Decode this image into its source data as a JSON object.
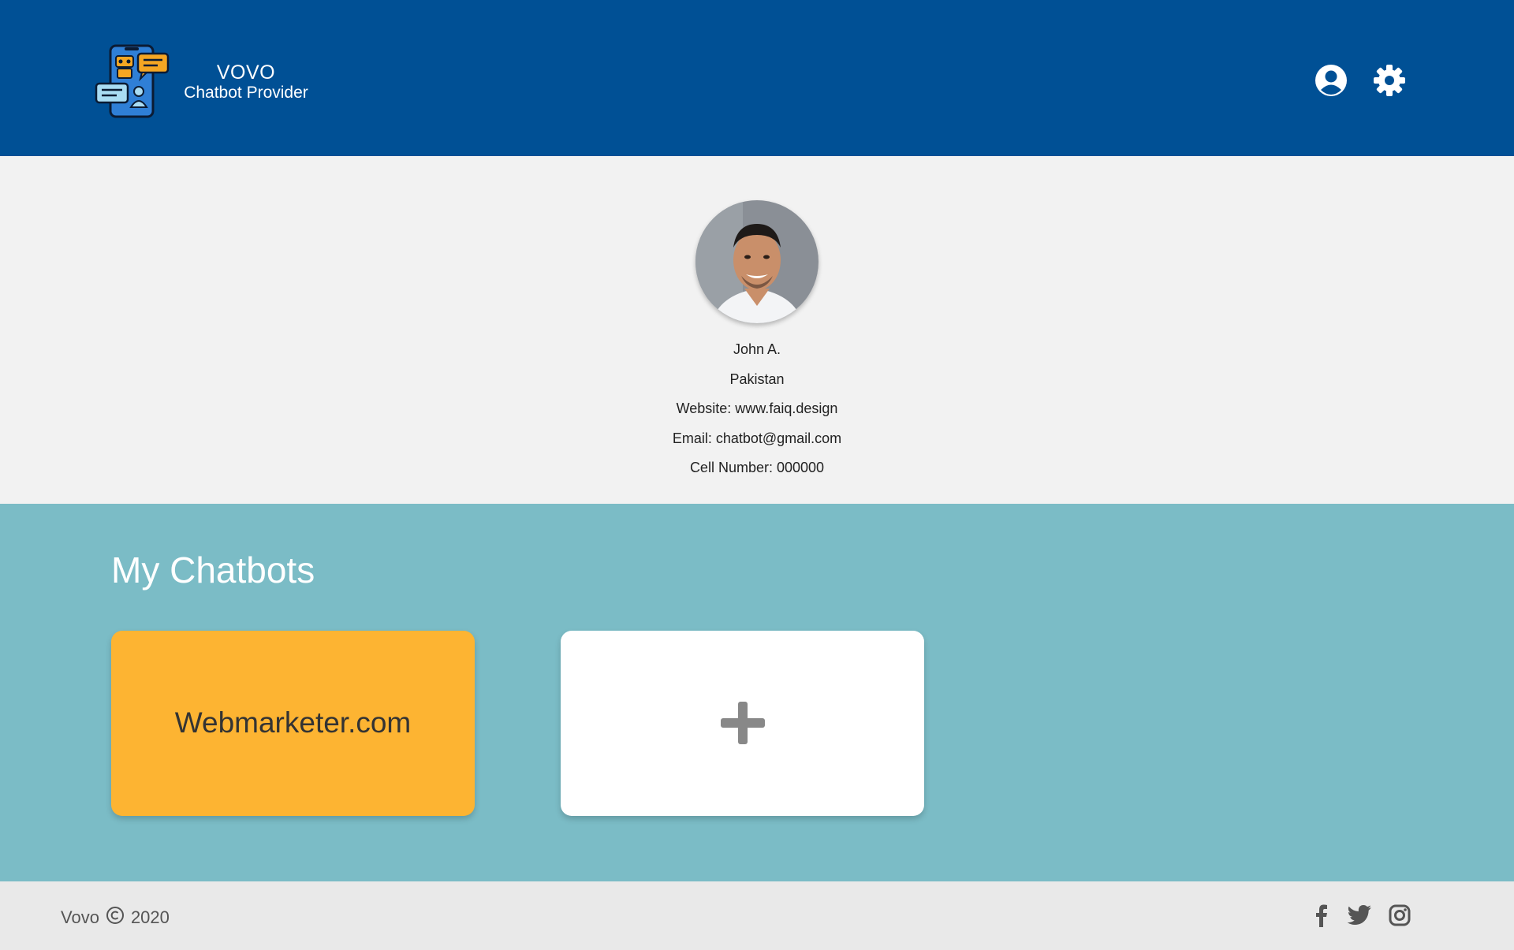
{
  "header": {
    "brand_name": "VOVO",
    "brand_tagline": "Chatbot Provider",
    "icons": [
      "user-circle-icon",
      "gear-icon"
    ]
  },
  "profile": {
    "name": "John A.",
    "country": "Pakistan",
    "website": "Website: www.faiq.design",
    "email": "Email: chatbot@gmail.com",
    "cell": "Cell Number: 000000"
  },
  "chatbots": {
    "title": "My Chatbots",
    "items": [
      {
        "label": "Webmarketer.com",
        "color": "#fdb432"
      }
    ],
    "add_icon": "plus-icon"
  },
  "footer": {
    "brand": "Vovo",
    "year": "2020",
    "social_icons": [
      "facebook-icon",
      "twitter-icon",
      "instagram-icon"
    ]
  },
  "colors": {
    "header_bg": "#005095",
    "profile_bg": "#f2f2f2",
    "section_bg": "#7bbcc6",
    "card_accent": "#fdb432",
    "footer_bg": "#e9e9e9"
  }
}
